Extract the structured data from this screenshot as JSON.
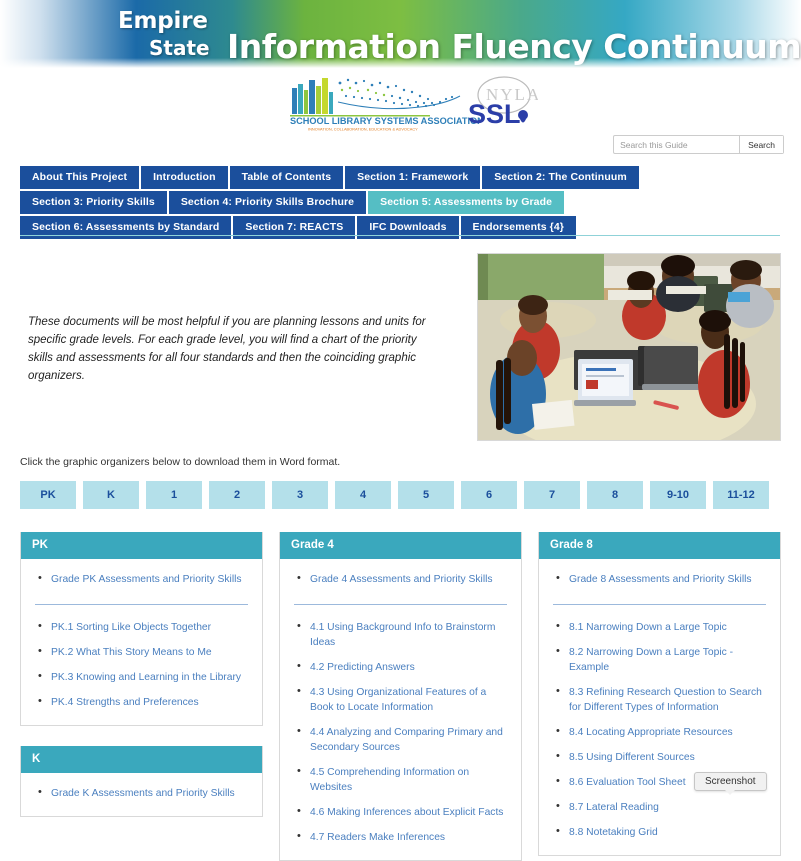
{
  "banner": {
    "line1": "Empire",
    "line2": "State",
    "title": "Information Fluency Continuum"
  },
  "logos": {
    "slsa_name": "SCHOOL LIBRARY SYSTEMS ASSOCIATION",
    "slsa_tagline": "INNOVATION, COLLABORATION, EDUCATION & ADVOCACY",
    "nysl_text": "SSL",
    "nysl_overlay": "NYLA"
  },
  "search": {
    "placeholder": "Search this Guide",
    "value": "",
    "button_label": "Search"
  },
  "tabs": {
    "row1": [
      {
        "label": "About This Project",
        "active": false
      },
      {
        "label": "Introduction",
        "active": false
      },
      {
        "label": "Table of Contents",
        "active": false
      },
      {
        "label": "Section 1: Framework",
        "active": false
      },
      {
        "label": "Section 2: The Continuum",
        "active": false
      }
    ],
    "row2": [
      {
        "label": "Section 3: Priority Skills",
        "active": false
      },
      {
        "label": "Section 4: Priority Skills Brochure",
        "active": false
      },
      {
        "label": "Section 5: Assessments by Grade",
        "active": true
      }
    ],
    "row3": [
      {
        "label": "Section 6: Assessments by Standard",
        "active": false
      },
      {
        "label": "Section 7: REACTS",
        "active": false
      },
      {
        "label": "IFC Downloads",
        "active": false
      },
      {
        "label": "Endorsements {4}",
        "active": false
      }
    ]
  },
  "intro": {
    "paragraph": "These documents will be most helpful if you are planning lessons and units for specific grade levels.  For each grade level, you will find a chart of the priority skills and assessments for all four standards and then the coinciding graphic organizers.",
    "click_note": "Click the graphic organizers below to download them in Word format."
  },
  "grade_buttons": [
    "PK",
    "K",
    "1",
    "2",
    "3",
    "4",
    "5",
    "6",
    "7",
    "8",
    "9-10",
    "11-12"
  ],
  "columns": [
    {
      "boxes": [
        {
          "title": "PK",
          "top_links": [
            "Grade PK Assessments and Priority Skills"
          ],
          "links": [
            "PK.1 Sorting Like Objects Together",
            "PK.2 What This Story Means to Me",
            "PK.3 Knowing and Learning in the Library",
            "PK.4 Strengths and Preferences"
          ]
        },
        {
          "title": "K",
          "top_links": [
            "Grade K Assessments and Priority Skills"
          ],
          "links": []
        }
      ]
    },
    {
      "boxes": [
        {
          "title": "Grade 4",
          "top_links": [
            "Grade 4 Assessments and Priority Skills"
          ],
          "links": [
            "4.1 Using Background Info to Brainstorm Ideas",
            "4.2 Predicting Answers",
            "4.3 Using Organizational Features of a Book to Locate Information",
            "4.4 Analyzing and Comparing Primary and Secondary Sources",
            "4.5 Comprehending Information on Websites",
            "4.6 Making Inferences about Explicit Facts",
            "4.7 Readers Make Inferences"
          ]
        }
      ]
    },
    {
      "boxes": [
        {
          "title": "Grade 8",
          "top_links": [
            "Grade 8 Assessments and Priority Skills"
          ],
          "links": [
            "8.1 Narrowing Down a Large Topic",
            "8.2 Narrowing Down a Large Topic - Example",
            "8.3 Refining Research Question to Search for Different Types of Information",
            "8.4 Locating Appropriate Resources",
            "8.5 Using Different Sources",
            "8.6 Evaluation Tool Sheet",
            "8.7 Lateral Reading",
            "8.8 Notetaking Grid"
          ]
        }
      ]
    }
  ],
  "tooltip": {
    "label": "Screenshot"
  },
  "colors": {
    "tab": "#1b4f9c",
    "tab_active": "#55bec4",
    "box_header": "#3aa8bd",
    "grade_button": "#b4e0ea",
    "link": "#4a7fbf"
  }
}
